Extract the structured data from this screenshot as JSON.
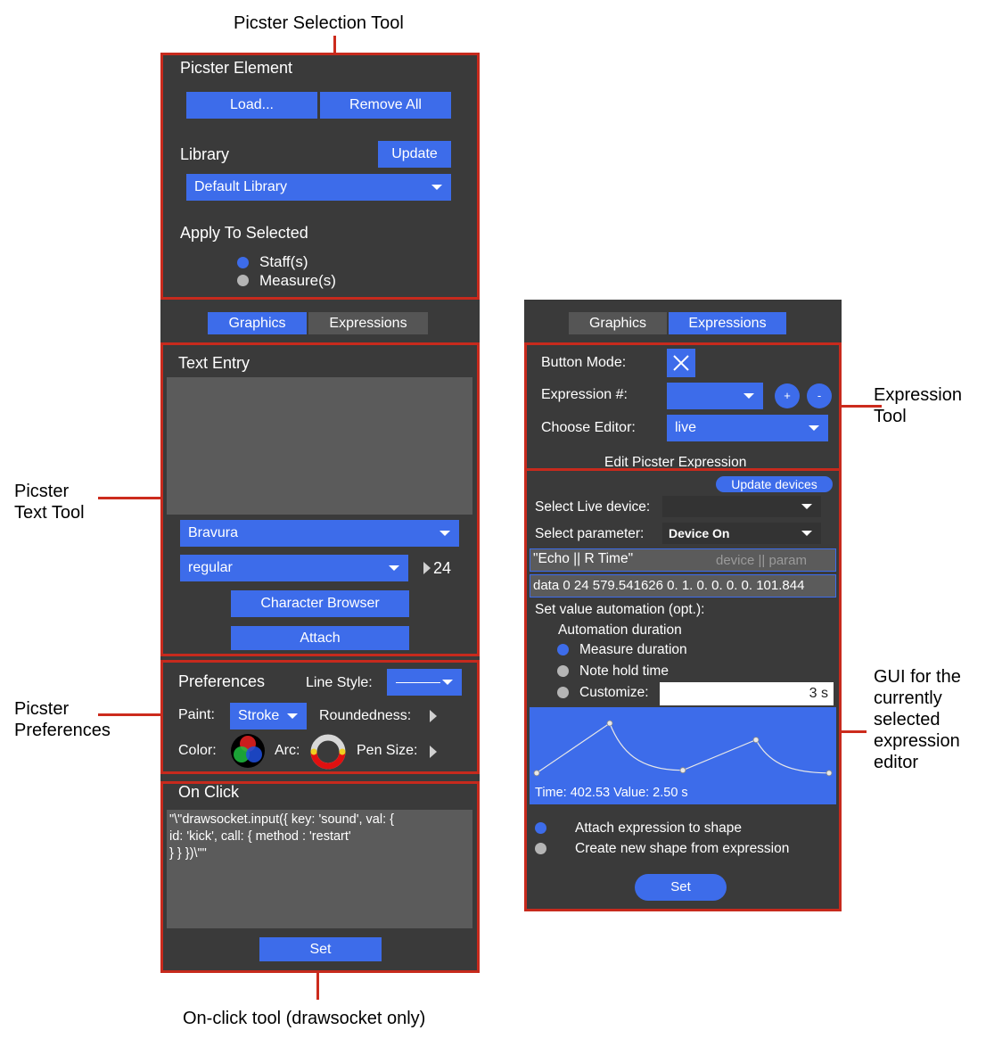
{
  "annotations": {
    "selection_tool": "Picster Selection Tool",
    "text_tool_1": "Picster",
    "text_tool_2": "Text Tool",
    "preferences_1": "Picster",
    "preferences_2": "Preferences",
    "onclick_tool": "On-click tool (drawsocket only)",
    "expression_tool_1": "Expression",
    "expression_tool_2": "Tool",
    "gui_1": "GUI for the",
    "gui_2": "currently",
    "gui_3": "selected",
    "gui_4": "expression",
    "gui_5": "editor"
  },
  "left": {
    "element": {
      "title": "Picster Element",
      "load": "Load...",
      "remove_all": "Remove All",
      "library_label": "Library",
      "update": "Update",
      "library_value": "Default Library",
      "apply_label": "Apply To Selected",
      "options": [
        "Staff(s)",
        "Measure(s)"
      ]
    },
    "tabs": [
      "Graphics",
      "Expressions"
    ],
    "text_entry": {
      "title": "Text Entry",
      "font": "Bravura",
      "style": "regular",
      "size": "24",
      "character_browser": "Character Browser",
      "attach": "Attach"
    },
    "preferences": {
      "title": "Preferences",
      "line_style_label": "Line Style:",
      "paint_label": "Paint:",
      "paint_value": "Stroke",
      "roundedness_label": "Roundedness:",
      "color_label": "Color:",
      "arc_label": "Arc:",
      "pen_size_label": "Pen Size:"
    },
    "on_click": {
      "title": "On Click",
      "code_line1": "\"\\\"drawsocket.input({  key: 'sound',       val: {",
      "code_line2": "id: 'kick',        call: {           method : 'restart'",
      "code_line3": "}      }     })\\\"\"",
      "set": "Set"
    }
  },
  "right": {
    "tabs": [
      "Graphics",
      "Expressions"
    ],
    "expression": {
      "button_mode_label": "Button Mode:",
      "expression_num_label": "Expression #:",
      "choose_editor_label": "Choose Editor:",
      "editor_value": "live",
      "plus": "+",
      "minus": "-",
      "edit_label": "Edit Picster Expression"
    },
    "editor": {
      "update_devices": "Update devices",
      "select_device_label": "Select Live device:",
      "select_param_label": "Select parameter:",
      "param_value": "Device On",
      "echo_text": "\"Echo || R Time\"",
      "echo_hint": "device || param",
      "data_text": "data 0 24 579.541626 0. 1. 0. 0. 0. 0. 101.844",
      "automation_label": "Set value automation (opt.):",
      "duration_label": "Automation duration",
      "duration_options": [
        "Measure duration",
        "Note hold time",
        "Customize:"
      ],
      "custom_value": "3 s",
      "readout": "Time: 402.53 Value: 2.50 s",
      "attach_options": [
        "Attach expression to shape",
        "Create new shape from expression"
      ],
      "set": "Set"
    }
  },
  "colors": {
    "accent": "#3d6cea",
    "panel": "#3a3a3a",
    "outline": "#c72a1d"
  },
  "chart_data": {
    "type": "line",
    "points": [
      [
        0,
        0.1
      ],
      [
        0.25,
        1.0
      ],
      [
        0.5,
        0.15
      ],
      [
        0.75,
        0.7
      ],
      [
        1.0,
        0.1
      ]
    ]
  }
}
